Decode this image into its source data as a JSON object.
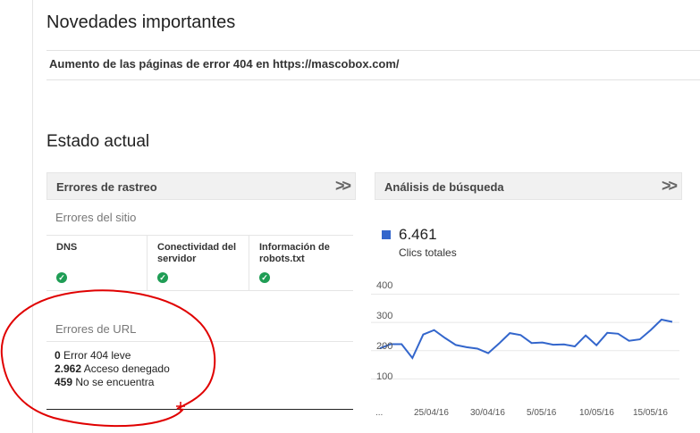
{
  "section_title": "Novedades importantes",
  "notice": "Aumento de las páginas de error 404 en https://mascobox.com/",
  "status_title": "Estado actual",
  "crawl": {
    "title": "Errores de rastreo",
    "site_errors": "Errores del sitio",
    "columns": [
      {
        "label": "DNS",
        "status": "ok"
      },
      {
        "label": "Conectividad del servidor",
        "status": "ok"
      },
      {
        "label": "Información de robots.txt",
        "status": "ok"
      }
    ],
    "url_errors_title": "Errores de URL",
    "url_errors": [
      {
        "count": "0",
        "label": "Error 404 leve"
      },
      {
        "count": "2.962",
        "label": "Acceso denegado"
      },
      {
        "count": "459",
        "label": "No se encuentra"
      }
    ]
  },
  "search": {
    "title": "Análisis de búsqueda",
    "total_value": "6.461",
    "total_label": "Clics totales",
    "color": "#3366cc"
  },
  "chart_data": {
    "type": "line",
    "series": [
      {
        "values": [
          208,
          223,
          223,
          174,
          257,
          273,
          245,
          220,
          212,
          207,
          191,
          225,
          262,
          255,
          227,
          229,
          221,
          222,
          215,
          254,
          219,
          263,
          260,
          235,
          240,
          273,
          310,
          302
        ]
      }
    ],
    "y_ticks": [
      "400",
      "300",
      "200",
      "100"
    ],
    "ylim": [
      0,
      430
    ],
    "x_labels": [
      "...",
      "25/04/16",
      "30/04/16",
      "5/05/16",
      "10/05/16",
      "15/05/16"
    ],
    "grid": true
  },
  "annotation_color": "#e00000"
}
